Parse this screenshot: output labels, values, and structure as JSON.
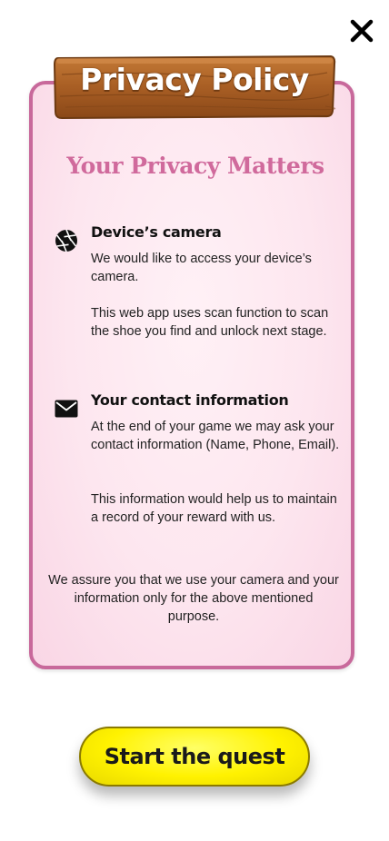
{
  "modal": {
    "title": "Privacy Policy",
    "subtitle": "Your Privacy Matters",
    "close_icon": "close-icon",
    "sections": [
      {
        "icon": "camera-aperture-icon",
        "heading": "Device’s camera",
        "paragraphs": [
          "We would like to access your device’s camera.",
          "This web app uses scan function to scan the shoe you find and unlock next stage."
        ]
      },
      {
        "icon": "envelope-icon",
        "heading": "Your contact information",
        "paragraphs": [
          "At the end of your game we may ask your contact information (Name, Phone, Email).",
          "This information would help us to maintain a record of your reward with us."
        ]
      }
    ],
    "assurance": "We assure you that we use your camera and your information only for the above mentioned purpose."
  },
  "actions": {
    "start_label": "Start the quest"
  },
  "colors": {
    "card_border": "#c8699b",
    "subtitle": "#d06a9c",
    "button_yellow": "#fff200",
    "plank_brown": "#b56a2c"
  }
}
